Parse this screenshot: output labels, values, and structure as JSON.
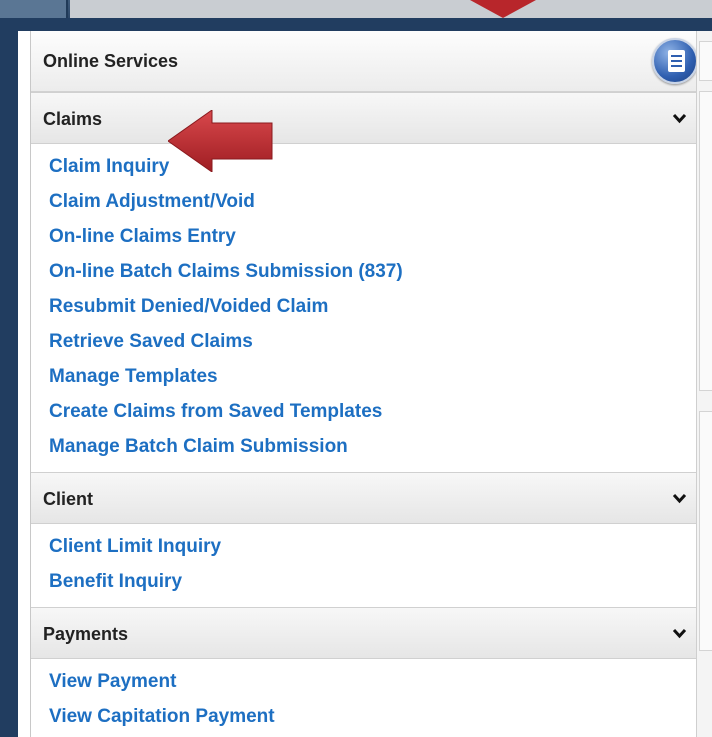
{
  "panel": {
    "title": "Online Services",
    "icon": "document-icon"
  },
  "sections": {
    "claims": {
      "title": "Claims",
      "links": [
        "Claim Inquiry",
        "Claim Adjustment/Void",
        "On-line Claims Entry",
        "On-line Batch Claims Submission (837)",
        "Resubmit Denied/Voided Claim",
        "Retrieve Saved Claims",
        "Manage Templates",
        "Create Claims from Saved Templates",
        "Manage Batch Claim Submission"
      ]
    },
    "client": {
      "title": "Client",
      "links": [
        "Client Limit Inquiry",
        "Benefit Inquiry"
      ]
    },
    "payments": {
      "title": "Payments",
      "links": [
        "View Payment",
        "View Capitation Payment"
      ]
    }
  },
  "colors": {
    "link": "#1d6fc2",
    "arrow": "#b8262b",
    "frame": "#213d60"
  }
}
